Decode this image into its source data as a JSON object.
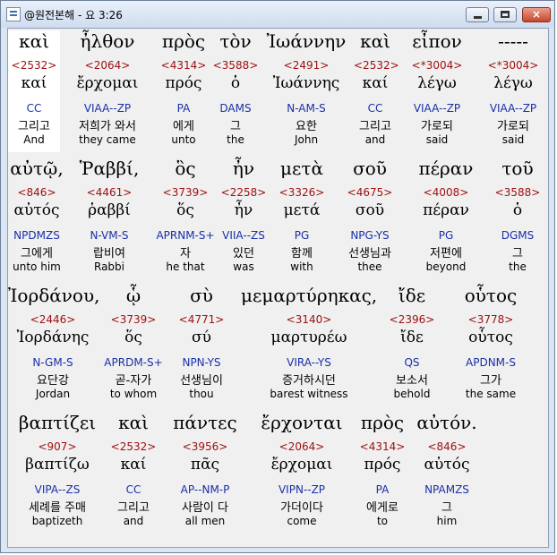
{
  "window": {
    "title": "@원전본해 - 요 3:26",
    "buttons": {
      "minimize": "minimize",
      "maximize": "maximize",
      "close": "×"
    }
  },
  "rows": [
    {
      "words": [
        {
          "greek": "καὶ",
          "strongs": "<2532>",
          "lexeme": "καί",
          "parsing": "CC",
          "korean": "그리고",
          "english": "And"
        },
        {
          "greek": "ἦλθον",
          "strongs": "<2064>",
          "lexeme": "ἔρχομαι",
          "parsing": "VIAA--ZP",
          "korean": "저희가 와서",
          "english": "they came"
        },
        {
          "greek": "πρὸς",
          "strongs": "<4314>",
          "lexeme": "πρός",
          "parsing": "PA",
          "korean": "에게",
          "english": "unto"
        },
        {
          "greek": "τὸν",
          "strongs": "<3588>",
          "lexeme": "ὁ",
          "parsing": "DAMS",
          "korean": "그",
          "english": "the"
        },
        {
          "greek": "Ἰωάννην",
          "strongs": "<2491>",
          "lexeme": "Ἰωάννης",
          "parsing": "N-AM-S",
          "korean": "요한",
          "english": "John"
        },
        {
          "greek": "καὶ",
          "strongs": "<2532>",
          "lexeme": "καί",
          "parsing": "CC",
          "korean": "그리고",
          "english": "and"
        },
        {
          "greek": "εἶπον",
          "strongs": "<*3004>",
          "lexeme": "λέγω",
          "parsing": "VIAA--ZP",
          "korean": "가로되",
          "english": "said"
        },
        {
          "greek": "-----",
          "strongs": "<*3004>",
          "lexeme": "λέγω",
          "parsing": "VIAA--ZP",
          "korean": "가로되",
          "english": "said"
        }
      ]
    },
    {
      "words": [
        {
          "greek": "αὐτῷ,",
          "strongs": "<846>",
          "lexeme": "αὐτός",
          "parsing": "NPDMZS",
          "korean": "그에게",
          "english": "unto him"
        },
        {
          "greek": "Ῥαββί,",
          "strongs": "<4461>",
          "lexeme": "ῥαββί",
          "parsing": "N-VM-S",
          "korean": "랍비여",
          "english": "Rabbi"
        },
        {
          "greek": "ὃς",
          "strongs": "<3739>",
          "lexeme": "ὅς",
          "parsing": "APRNM-S+",
          "korean": "자",
          "english": "he that"
        },
        {
          "greek": "ἦν",
          "strongs": "<2258>",
          "lexeme": "ἦν",
          "parsing": "VIIA--ZS",
          "korean": "있던",
          "english": "was"
        },
        {
          "greek": "μετὰ",
          "strongs": "<3326>",
          "lexeme": "μετά",
          "parsing": "PG",
          "korean": "함께",
          "english": "with"
        },
        {
          "greek": "σοῦ",
          "strongs": "<4675>",
          "lexeme": "σοῦ",
          "parsing": "NPG-YS",
          "korean": "선생님과",
          "english": "thee"
        },
        {
          "greek": "πέραν",
          "strongs": "<4008>",
          "lexeme": "πέραν",
          "parsing": "PG",
          "korean": "저편에",
          "english": "beyond"
        },
        {
          "greek": "τοῦ",
          "strongs": "<3588>",
          "lexeme": "ὁ",
          "parsing": "DGMS",
          "korean": "그",
          "english": "the"
        }
      ]
    },
    {
      "words": [
        {
          "greek": "Ἰορδάνου,",
          "strongs": "<2446>",
          "lexeme": "Ἰορδάνης",
          "parsing": "N-GM-S",
          "korean": "요단강",
          "english": "Jordan"
        },
        {
          "greek": "ᾧ",
          "strongs": "<3739>",
          "lexeme": "ὅς",
          "parsing": "APRDM-S+",
          "korean": "곧-자가",
          "english": "to whom"
        },
        {
          "greek": "σὺ",
          "strongs": "<4771>",
          "lexeme": "σύ",
          "parsing": "NPN-YS",
          "korean": "선생님이",
          "english": "thou"
        },
        {
          "greek": "μεμαρτύρηκας,",
          "strongs": "<3140>",
          "lexeme": "μαρτυρέω",
          "parsing": "VIRA--YS",
          "korean": "증거하시던",
          "english": "barest witness"
        },
        {
          "greek": "ἴδε",
          "strongs": "<2396>",
          "lexeme": "ἴδε",
          "parsing": "QS",
          "korean": "보소서",
          "english": "behold"
        },
        {
          "greek": "οὗτος",
          "strongs": "<3778>",
          "lexeme": "οὗτος",
          "parsing": "APDNM-S",
          "korean": "그가",
          "english": "the same"
        }
      ]
    },
    {
      "words": [
        {
          "greek": "βαπτίζει",
          "strongs": "<907>",
          "lexeme": "βαπτίζω",
          "parsing": "VIPA--ZS",
          "korean": "세례를 주매",
          "english": "baptizeth"
        },
        {
          "greek": "καὶ",
          "strongs": "<2532>",
          "lexeme": "καί",
          "parsing": "CC",
          "korean": "그리고",
          "english": "and"
        },
        {
          "greek": "πάντες",
          "strongs": "<3956>",
          "lexeme": "πᾶς",
          "parsing": "AP--NM-P",
          "korean": "사람이 다",
          "english": "all men"
        },
        {
          "greek": "ἔρχονται",
          "strongs": "<2064>",
          "lexeme": "ἔρχομαι",
          "parsing": "VIPN--ZP",
          "korean": "가더이다",
          "english": "come"
        },
        {
          "greek": "πρὸς",
          "strongs": "<4314>",
          "lexeme": "πρός",
          "parsing": "PA",
          "korean": "에게로",
          "english": "to"
        },
        {
          "greek": "αὐτόν.",
          "strongs": "<846>",
          "lexeme": "αὐτός",
          "parsing": "NPAMZS",
          "korean": "그",
          "english": "him"
        }
      ]
    }
  ]
}
